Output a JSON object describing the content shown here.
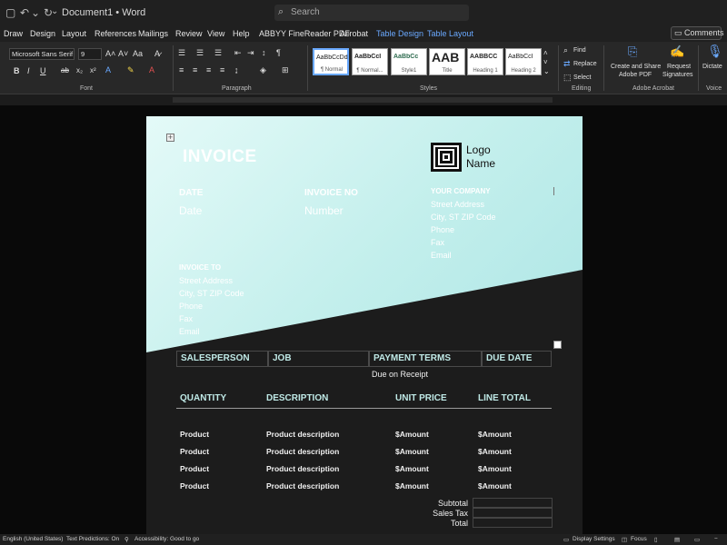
{
  "titlebar": {
    "doc_title": "Document1 • Word",
    "search_placeholder": "Search"
  },
  "menu": {
    "tabs": [
      "Draw",
      "Design",
      "Layout",
      "References",
      "Mailings",
      "Review",
      "View",
      "Help",
      "ABBYY FineReader PDF",
      "Acrobat"
    ],
    "context_tabs": [
      "Table Design",
      "Table Layout"
    ],
    "comments_label": "Comments"
  },
  "ribbon": {
    "font_name": "Microsoft Sans Serif",
    "font_size": "9",
    "font_group": "Font",
    "paragraph_group": "Paragraph",
    "styles_group": "Styles",
    "editing_group": "Editing",
    "acrobat_group": "Adobe Acrobat",
    "voice_group": "Voice",
    "styles": [
      {
        "sample": "AaBbCcDd",
        "name": "¶ Normal"
      },
      {
        "sample": "AaBbCcI",
        "name": "¶ Normal..."
      },
      {
        "sample": "AaBbCc",
        "name": "Style1"
      },
      {
        "sample": "AAB",
        "name": "Title"
      },
      {
        "sample": "AABBCC",
        "name": "Heading 1"
      },
      {
        "sample": "AaBbCcI",
        "name": "Heading 2"
      }
    ],
    "find": "Find",
    "replace": "Replace",
    "select": "Select",
    "create_share_1": "Create and Share",
    "create_share_2": "Adobe PDF",
    "request_sig_1": "Request",
    "request_sig_2": "Signatures",
    "dictate": "Dictate"
  },
  "invoice": {
    "title": "INVOICE",
    "date_label": "DATE",
    "date_value": "Date",
    "invoice_no_label": "INVOICE NO",
    "invoice_no_value": "Number",
    "logo_line1": "Logo",
    "logo_line2": "Name",
    "company_label": "YOUR COMPANY",
    "company_lines": [
      "Street Address",
      "City, ST ZIP Code",
      "Phone",
      "Fax",
      "Email"
    ],
    "invoice_to_label": "INVOICE TO",
    "invoice_to_lines": [
      "Street Address",
      "City, ST ZIP Code",
      "Phone",
      "Fax",
      "Email"
    ],
    "header_cells": [
      "SALESPERSON",
      "JOB",
      "PAYMENT TERMS",
      "DUE DATE"
    ],
    "payment_terms_value": "Due on Receipt",
    "items_headers": [
      "QUANTITY",
      "DESCRIPTION",
      "UNIT PRICE",
      "LINE TOTAL"
    ],
    "items": [
      {
        "qty": "Product",
        "desc": "Product description",
        "unit": "$Amount",
        "total": "$Amount"
      },
      {
        "qty": "Product",
        "desc": "Product description",
        "unit": "$Amount",
        "total": "$Amount"
      },
      {
        "qty": "Product",
        "desc": "Product description",
        "unit": "$Amount",
        "total": "$Amount"
      },
      {
        "qty": "Product",
        "desc": "Product description",
        "unit": "$Amount",
        "total": "$Amount"
      }
    ],
    "subtotal_label": "Subtotal",
    "sales_tax_label": "Sales Tax",
    "total_label": "Total"
  },
  "status": {
    "language": "English (United States)",
    "text_predictions": "Text Predictions: On",
    "accessibility": "Accessibility: Good to go",
    "display_settings": "Display Settings",
    "focus": "Focus"
  }
}
